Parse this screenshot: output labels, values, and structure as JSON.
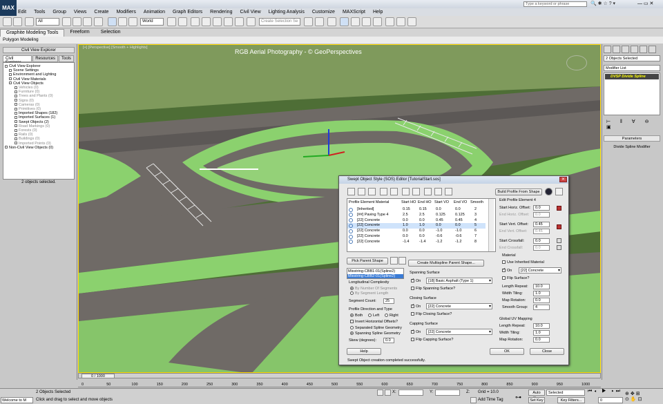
{
  "search": {
    "placeholder": "Type a keyword or phrase"
  },
  "menu": [
    "Edit",
    "Tools",
    "Group",
    "Views",
    "Create",
    "Modifiers",
    "Animation",
    "Graph Editors",
    "Rendering",
    "Civil View",
    "Lighting Analysis",
    "Customize",
    "MAXScript",
    "Help"
  ],
  "toolbar": {
    "filter": "All",
    "coord": "World",
    "selection_set": "Create Selection Se"
  },
  "ribbon": {
    "tabs": [
      "Graphite Modeling Tools",
      "Freeform",
      "Selection"
    ],
    "sub": "Polygon Modeling"
  },
  "explorer": {
    "title": "Civil View Explorer",
    "tabs": [
      "Civil Explorer",
      "Resources",
      "Tools"
    ],
    "items": [
      {
        "label": "Civil View Explorer",
        "dim": false
      },
      {
        "label": "Scene Settings",
        "dim": false
      },
      {
        "label": "Environment and Lighting",
        "dim": false
      },
      {
        "label": "Civil View Materials",
        "dim": false
      },
      {
        "label": "Civil View Objects",
        "dim": false
      },
      {
        "label": "Vehicles (0)",
        "dim": true
      },
      {
        "label": "Furniture (0)",
        "dim": true
      },
      {
        "label": "Trees and Plants (0)",
        "dim": true
      },
      {
        "label": "Signs (0)",
        "dim": true
      },
      {
        "label": "Cameras (0)",
        "dim": true
      },
      {
        "label": "Primitives (0)",
        "dim": true
      },
      {
        "label": "Imported Shapes (182)",
        "dim": false
      },
      {
        "label": "Imported Surfaces (1)",
        "dim": false
      },
      {
        "label": "Swept Objects (2)",
        "dim": false
      },
      {
        "label": "Road Markings (0)",
        "dim": true
      },
      {
        "label": "Forests (0)",
        "dim": true
      },
      {
        "label": "Rails (0)",
        "dim": true
      },
      {
        "label": "Buildings (0)",
        "dim": true
      },
      {
        "label": "Imported Points (0)",
        "dim": true
      },
      {
        "label": "Non-Civil View Objects (0)",
        "dim": false
      }
    ],
    "status": "2 objects selected."
  },
  "viewport": {
    "label": "[+] [Perspective] [Smooth + Highlights]",
    "title": "RGB Aerial Photography - © GeoPerspectives"
  },
  "command_panel": {
    "selected": "2 Objects Selected",
    "modifier_list": "Modifier List",
    "stack_item": "DVSP Divide Spline",
    "params_title": "Parameters",
    "params_name": "Divide Spline Modifier"
  },
  "dialog": {
    "title": "Swept Object Style (SOS) Editor [TutorialStart.sos]",
    "build_btn": "Build Profile From Shape",
    "columns": [
      "Profile Element Material",
      "Start HO",
      "End HO",
      "Start VO",
      "End VO",
      "Smooth"
    ],
    "rows": [
      {
        "name": "[Inherited]",
        "sho": "0.15",
        "eho": "0.15",
        "svo": "0.0",
        "evo": "0.0",
        "sm": "2"
      },
      {
        "name": "[##] Paving Type 4",
        "sho": "2.5",
        "eho": "2.5",
        "svo": "0.125",
        "evo": "0.125",
        "sm": "3"
      },
      {
        "name": "[22] Concrete",
        "sho": "0.0",
        "eho": "0.0",
        "svo": "0.45",
        "evo": "0.45",
        "sm": "4"
      },
      {
        "name": "[22] Concrete",
        "sho": "1.0",
        "eho": "1.0",
        "svo": "0.0",
        "evo": "0.0",
        "sm": "5"
      },
      {
        "name": "[22] Concrete",
        "sho": "0.0",
        "eho": "0.0",
        "svo": "-1.0",
        "evo": "-1.0",
        "sm": "6"
      },
      {
        "name": "[22] Concrete",
        "sho": "0.0",
        "eho": "0.0",
        "svo": "-0.6",
        "evo": "-0.6",
        "sm": "7"
      },
      {
        "name": "[22] Concrete",
        "sho": "-1.4",
        "eho": "-1.4",
        "svo": "-1.2",
        "evo": "-1.2",
        "sm": "8"
      }
    ],
    "pick_btn": "Pick Parent Shape",
    "shapes": [
      "Mixstring-CBB1-01(Spline2)",
      "Mixstring-CBB2-01(Spline2)"
    ],
    "multispline_btn": "Create Multispline Parent Shape...",
    "longitudinal": "Longitudinal Complexity",
    "by_segments": "By Number Of Segments",
    "by_length": "By Segment Length",
    "segment_count_label": "Segment Count:",
    "segment_count": "25",
    "direction_label": "Profile Direction and Type",
    "both": "Both",
    "left": "Left",
    "right": "Right",
    "invert": "Invert Horizontal Offsets?",
    "separated": "Separated Spline Geometry",
    "spanning_geom": "Spanning Spline Geometry",
    "skew_label": "Skew (degrees):",
    "skew": "0.0",
    "help_btn": "Help",
    "spanning_title": "Spanning Surface",
    "spanning_mat": "[18] Basic Asphalt (Type 1)",
    "flip_spanning": "Flip Spanning Surface?",
    "closing_title": "Closing Surface",
    "closing_mat": "[22] Concrete",
    "flip_closing": "Flip Closing Surface?",
    "capping_title": "Capping Surface",
    "capping_mat": "[22] Concrete",
    "flip_capping": "Flip Capping Surface?",
    "on": "On",
    "edit_title": "Edit Profile Element 4",
    "start_h_label": "Start Horiz. Offset:",
    "start_h": "0.0",
    "end_h_label": "End Horiz. Offset:",
    "end_h": "0.0",
    "start_v_label": "Start Vert. Offset:",
    "start_v": "0.45",
    "end_v_label": "End Vert. Offset:",
    "end_v": "0.45",
    "start_cf_label": "Start Crossfall:",
    "start_cf": "0.0",
    "end_cf_label": "End Crossfall:",
    "end_cf": "0.0",
    "material_title": "Material",
    "use_inherited": "Use Inherited Material",
    "mat_value": "[22] Concrete",
    "flip_surface": "Flip Surface?",
    "length_repeat_label": "Length Repeat:",
    "length_repeat": "10.0",
    "width_tiling_label": "Width Tiling:",
    "width_tiling": "1.0",
    "map_rot_label": "Map Rotation:",
    "map_rot": "0.0",
    "smooth_group_label": "Smooth Group:",
    "smooth_group": "4",
    "global_uv": "Global UV Mapping",
    "g_length_repeat": "10.0",
    "g_width_tiling": "1.0",
    "g_map_rot": "0.0",
    "ok_btn": "OK",
    "close_btn": "Close",
    "status": "Swept Object creation completed successfully."
  },
  "timeline": {
    "thumb": "0 / 1000",
    "ticks": [
      "0",
      "50",
      "100",
      "150",
      "200",
      "250",
      "300",
      "350",
      "400",
      "450",
      "500",
      "550",
      "600",
      "650",
      "700",
      "750",
      "800",
      "850",
      "900",
      "950",
      "1000"
    ]
  },
  "status": {
    "welcome": "Welcome to M",
    "selected": "2 Objects Selected",
    "prompt": "Click and drag to select and move objects",
    "x": "X:",
    "y": "Y:",
    "z": "Z:",
    "grid": "Grid = 10.0",
    "add_time_tag": "Add Time Tag",
    "auto_key": "Auto Key",
    "key_mode": "Selected",
    "set_key": "Set Key",
    "key_filters": "Key Filters...",
    "frame": "0"
  }
}
